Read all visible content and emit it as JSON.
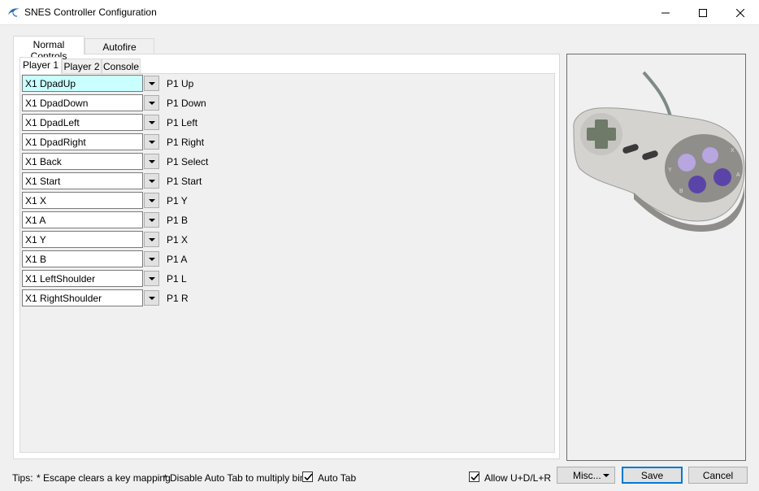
{
  "window": {
    "title": "SNES Controller Configuration"
  },
  "outer_tabs": [
    {
      "label": "Normal Controls",
      "active": true
    },
    {
      "label": "Autofire Controls",
      "active": false
    }
  ],
  "inner_tabs": [
    {
      "label": "Player 1",
      "active": true
    },
    {
      "label": "Player 2",
      "active": false
    },
    {
      "label": "Console",
      "active": false
    }
  ],
  "mappings": [
    {
      "binding": "X1 DpadUp",
      "label": "P1 Up",
      "focused": true
    },
    {
      "binding": "X1 DpadDown",
      "label": "P1 Down"
    },
    {
      "binding": "X1 DpadLeft",
      "label": "P1 Left"
    },
    {
      "binding": "X1 DpadRight",
      "label": "P1 Right"
    },
    {
      "binding": "X1 Back",
      "label": "P1 Select"
    },
    {
      "binding": "X1 Start",
      "label": "P1 Start"
    },
    {
      "binding": "X1 X",
      "label": "P1 Y"
    },
    {
      "binding": "X1 A",
      "label": "P1 B"
    },
    {
      "binding": "X1 Y",
      "label": "P1 X"
    },
    {
      "binding": "X1 B",
      "label": "P1 A"
    },
    {
      "binding": "X1 LeftShoulder",
      "label": "P1 L"
    },
    {
      "binding": "X1 RightShoulder",
      "label": "P1 R"
    }
  ],
  "footer": {
    "tips_label": "Tips:",
    "tip1": "* Escape clears a key mapping",
    "tip2": "* Disable Auto Tab to multiply bind",
    "auto_tab_label": "Auto Tab",
    "auto_tab_checked": true,
    "allow_label": "Allow U+D/L+R",
    "allow_checked": true,
    "misc_label": "Misc...",
    "save_label": "Save",
    "cancel_label": "Cancel"
  },
  "controller_image": {
    "icon": "snes-controller-image",
    "button_labels": [
      "X",
      "Y",
      "A",
      "B"
    ]
  },
  "colors": {
    "focus_field": "#c9ffff",
    "default_button_border": "#0078d7",
    "controller_body": "#d4d3cf",
    "controller_button_purple": "#5b44a8",
    "controller_button_lilac": "#b7a6df"
  }
}
